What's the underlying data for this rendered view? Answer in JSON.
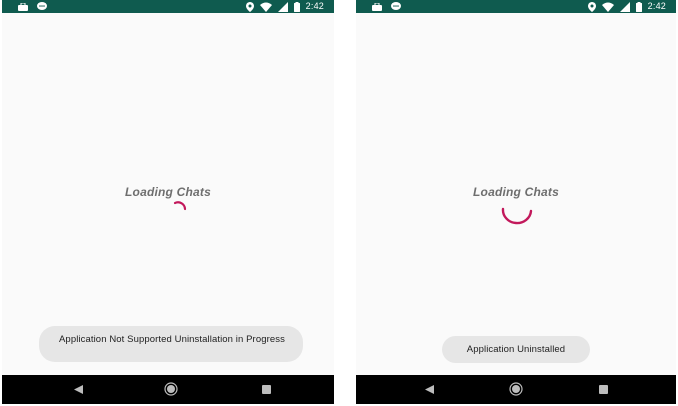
{
  "screens": [
    {
      "status_bar": {
        "time": "2:42"
      },
      "loading_text": "Loading Chats",
      "toast": "Application Not Supported Uninstallation in Progress"
    },
    {
      "status_bar": {
        "time": "2:42"
      },
      "loading_text": "Loading Chats",
      "toast": "Application Uninstalled"
    }
  ],
  "icons": {
    "status_left": [
      "briefcase-icon",
      "chat-bubble-icon"
    ],
    "status_right": [
      "location-icon",
      "wifi-icon",
      "cell-signal-icon",
      "battery-icon"
    ],
    "nav": [
      "back-icon",
      "home-icon",
      "recent-apps-icon"
    ]
  },
  "colors": {
    "status_bar": "#0f5b4f",
    "spinner": "#c2185b",
    "screen_background": "#fafafa",
    "toast_background": "#e6e6e6",
    "nav_bar": "#000000"
  }
}
